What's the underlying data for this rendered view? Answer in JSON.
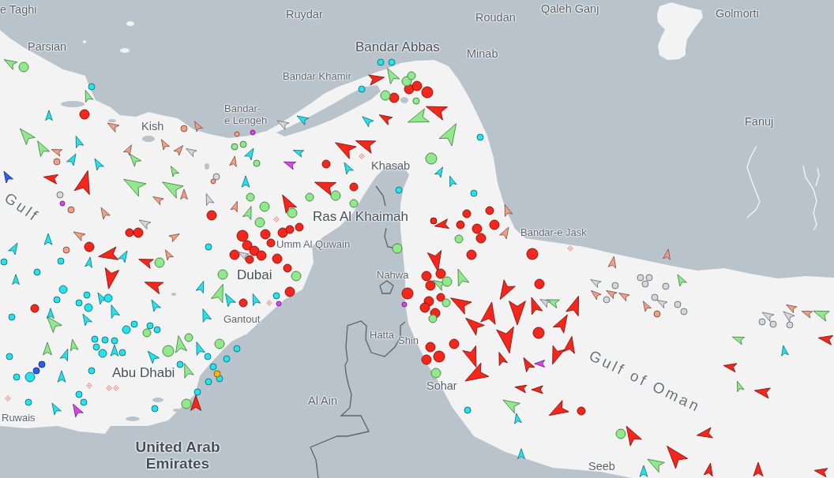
{
  "map": {
    "places": [
      {
        "name": "e Taghi",
        "kind": "city"
      },
      {
        "name": "Parsian",
        "kind": "city"
      },
      {
        "name": "Ruydar",
        "kind": "city"
      },
      {
        "name": "Roudan",
        "kind": "city"
      },
      {
        "name": "Qaleh Ganj",
        "kind": "city"
      },
      {
        "name": "Golmorti",
        "kind": "city"
      },
      {
        "name": "Bandar Abbas",
        "kind": "major"
      },
      {
        "name": "Minab",
        "kind": "city"
      },
      {
        "name": "Bandar Khamir",
        "kind": "town"
      },
      {
        "name": "Bandar-\ne Lengeh",
        "kind": "town"
      },
      {
        "name": "Kish",
        "kind": "city"
      },
      {
        "name": "Fanuj",
        "kind": "city"
      },
      {
        "name": "Khasab",
        "kind": "city"
      },
      {
        "name": "Ras Al Khaimah",
        "kind": "major"
      },
      {
        "name": "Bandar-e Jask",
        "kind": "town"
      },
      {
        "name": "Umm Al Quwain",
        "kind": "town"
      },
      {
        "name": "Dubai",
        "kind": "major"
      },
      {
        "name": "Gantout",
        "kind": "town"
      },
      {
        "name": "Nahwa",
        "kind": "town"
      },
      {
        "name": "Hatta",
        "kind": "town"
      },
      {
        "name": "Shin",
        "kind": "town"
      },
      {
        "name": "Sohar",
        "kind": "city"
      },
      {
        "name": "Abu Dhabi",
        "kind": "major"
      },
      {
        "name": "Al Ain",
        "kind": "city"
      },
      {
        "name": "United Arab Emirates",
        "kind": "country"
      },
      {
        "name": "Gulf of Oman",
        "kind": "sea"
      },
      {
        "name": "Gulf",
        "kind": "sea"
      },
      {
        "name": "Seeb",
        "kind": "city"
      },
      {
        "name": "Ruwais",
        "kind": "town"
      }
    ]
  },
  "vessel_markers": [
    {
      "kind": "arrow",
      "color": "#f5261b"
    },
    {
      "kind": "dot",
      "color": "#f5261b"
    },
    {
      "kind": "arrow",
      "color": "#90ea8c"
    },
    {
      "kind": "dot",
      "color": "#90ea8c"
    },
    {
      "kind": "arrow",
      "color": "#27e2ec"
    },
    {
      "kind": "dot",
      "color": "#27e2ec"
    },
    {
      "kind": "arrow",
      "color": "#f2a085"
    },
    {
      "kind": "dot",
      "color": "#f2a085"
    },
    {
      "kind": "arrow",
      "color": "#d4d8de"
    },
    {
      "kind": "dot",
      "color": "#d4d8de"
    },
    {
      "kind": "arrow",
      "color": "#d845ec"
    },
    {
      "kind": "dot",
      "color": "#d845ec"
    },
    {
      "kind": "arrow",
      "color": "#2f5df2"
    },
    {
      "kind": "dot",
      "color": "#2f5df2"
    },
    {
      "kind": "dot",
      "color": "#f6b60c"
    },
    {
      "kind": "diamond",
      "color": "#f8a4a4"
    }
  ]
}
